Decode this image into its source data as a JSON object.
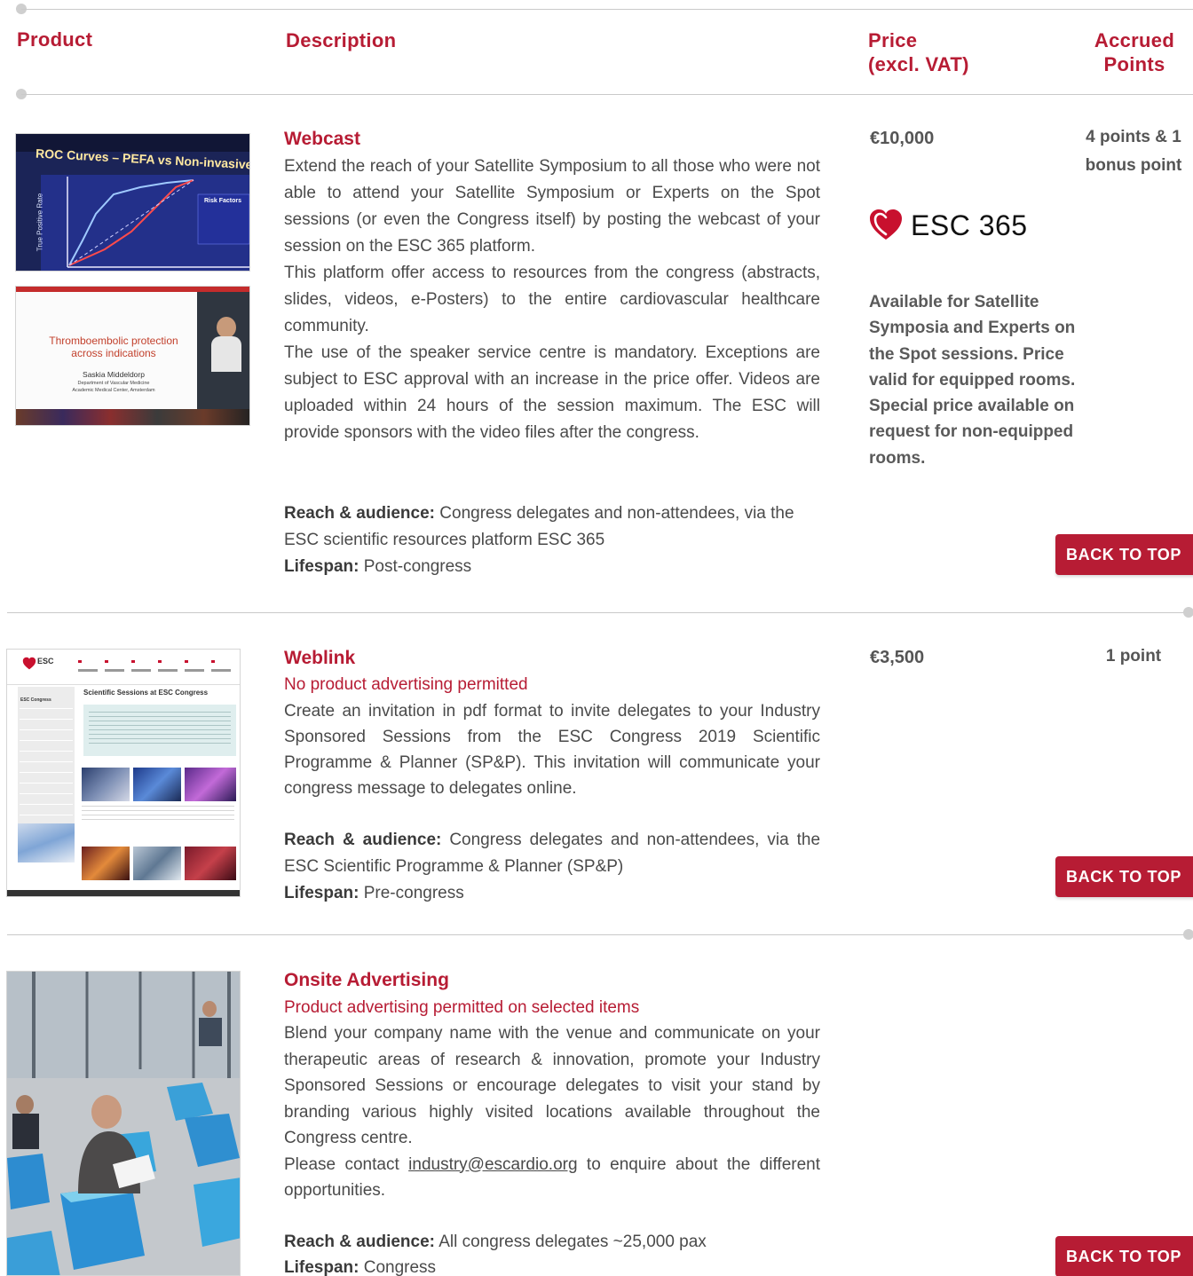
{
  "header": {
    "product": "Product",
    "description": "Description",
    "price": "Price\n(excl. VAT)",
    "points": "Accrued\nPoints"
  },
  "back_to_top": "BACK TO TOP",
  "products": [
    {
      "title": "Webcast",
      "paragraphs": [
        "Extend the reach of your Satellite Symposium to all those who were not able to attend your Satellite Symposium or Experts on the Spot sessions (or even the Congress itself) by posting the webcast of your session on the ESC 365 platform.",
        "This platform offer access to resources from the congress (abstracts, slides, videos, e-Posters) to the entire cardiovascular healthcare community.",
        "The use of the speaker service centre is mandatory. Exceptions are subject to ESC approval with an increase in the price offer. Videos are uploaded within 24 hours of the session maximum. The ESC will provide sponsors with the video files after the congress."
      ],
      "reach_label": "Reach & audience:",
      "reach": "Congress delegates and non-attendees, via the ESC scientific resources platform ESC 365",
      "lifespan_label": "Lifespan:",
      "lifespan": "Post-congress",
      "price": "€10,000",
      "points": "4 points & 1\nbonus point",
      "logo_label": "ESC 365",
      "note": "Available for Satellite Symposia and Experts on the Spot sessions. Price valid for equipped rooms.\nSpecial price available on request for non-equipped rooms.",
      "image1": {
        "slide_title": "ROC Curves – PEFA vs Non-invasive",
        "axis_label": "True Positive Rate",
        "risk_title": "Risk Factors"
      },
      "image2": {
        "slide_title": "Thromboembolic protection across indications",
        "speaker": "Saskia Middeldorp",
        "dept": "Department of Vascular Medicine",
        "inst": "Academic Medical Center, Amsterdam"
      }
    },
    {
      "title": "Weblink",
      "subtitle": "No product advertising permitted",
      "paragraphs": [
        "Create an invitation in pdf format to invite delegates to your Industry Sponsored Sessions from the ESC Congress 2019 Scientific Programme & Planner (SP&P). This invitation will communicate your congress message to delegates online."
      ],
      "reach_label": "Reach & audience:",
      "reach": "Congress delegates and non-attendees, via the ESC Scientific Programme & Planner (SP&P)",
      "lifespan_label": "Lifespan:",
      "lifespan": "Pre-congress",
      "price": "€3,500",
      "points": "1 point",
      "screenshot": {
        "logo": "ESC",
        "heading": "Scientific Sessions at ESC Congress",
        "sidebar_title": "ESC Congress"
      }
    },
    {
      "title": "Onsite Advertising",
      "subtitle": "Product advertising permitted on selected items",
      "paragraphs": [
        "Blend your company name with the venue and communicate on your therapeutic areas of research & innovation, promote your Industry Sponsored Sessions or encourage delegates to visit your stand by branding various highly visited locations available throughout the Congress centre."
      ],
      "contact_pre": "Please contact ",
      "contact_email": "industry@escardio.org",
      "contact_post": " to enquire about the different opportunities.",
      "reach_label": "Reach & audience:",
      "reach": "All congress delegates ~25,000 pax",
      "lifespan_label": "Lifespan:",
      "lifespan": "Congress"
    }
  ],
  "colors": {
    "accent": "#b71c34",
    "rule": "#c9c9c9",
    "text": "#4a4a4a"
  }
}
